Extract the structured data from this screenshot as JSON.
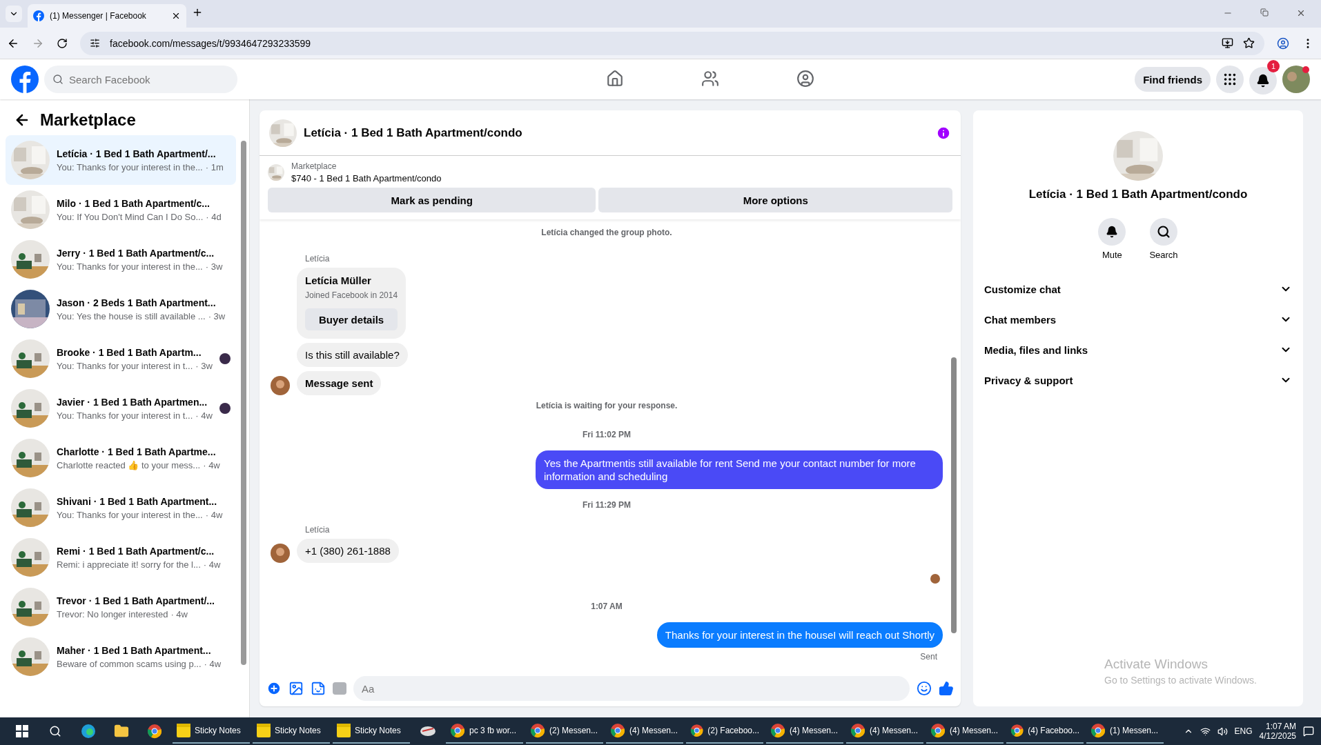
{
  "browser": {
    "tab": {
      "title": "(1) Messenger | Facebook"
    },
    "url": "facebook.com/messages/t/9934647293233599"
  },
  "header": {
    "search": {
      "placeholder": "Search Facebook"
    },
    "nav": [
      {
        "kind": "home",
        "selected": false
      },
      {
        "kind": "friends",
        "selected": false
      },
      {
        "kind": "groups",
        "selected": false
      }
    ],
    "find_friends": "Find friends",
    "notification_count": "1"
  },
  "sidebar": {
    "title": "Marketplace",
    "conversations": [
      {
        "title": "Letícia · 1 Bed 1 Bath Apartment/...",
        "preview": "You: Thanks for your interest in the...",
        "time": "· 1m",
        "selected": true,
        "seen": false
      },
      {
        "title": "Milo · 1 Bed 1 Bath Apartment/c...",
        "preview": "You: If You Don't Mind Can I Do So...",
        "time": "· 4d",
        "selected": false,
        "seen": false
      },
      {
        "title": "Jerry · 1 Bed 1 Bath Apartment/c...",
        "preview": "You: Thanks for your interest in the...",
        "time": "· 3w",
        "selected": false,
        "seen": false
      },
      {
        "title": "Jason · 2 Beds 1 Bath Apartment...",
        "preview": "You: Yes the house is still available ...",
        "time": "· 3w",
        "selected": false,
        "seen": false
      },
      {
        "title": "Brooke · 1 Bed 1 Bath Apartm...",
        "preview": "You: Thanks for your interest in t...",
        "time": "· 3w",
        "selected": false,
        "seen": true
      },
      {
        "title": "Javier · 1 Bed 1 Bath Apartmen...",
        "preview": "You: Thanks for your interest in t...",
        "time": "· 4w",
        "selected": false,
        "seen": true
      },
      {
        "title": "Charlotte · 1 Bed 1 Bath Apartme...",
        "preview": "Charlotte reacted 👍 to your mess...",
        "time": "· 4w",
        "selected": false,
        "seen": false
      },
      {
        "title": "Shivani · 1 Bed 1 Bath Apartment...",
        "preview": "You: Thanks for your interest in the...",
        "time": "· 4w",
        "selected": false,
        "seen": false
      },
      {
        "title": "Remi · 1 Bed 1 Bath Apartment/c...",
        "preview": "Remi: i appreciate it! sorry for the l...",
        "time": "· 4w",
        "selected": false,
        "seen": false
      },
      {
        "title": "Trevor · 1 Bed 1 Bath Apartment/...",
        "preview": "Trevor: No longer interested",
        "time": "· 4w",
        "selected": false,
        "seen": false
      },
      {
        "title": "Maher · 1 Bed 1 Bath Apartment...",
        "preview": "Beware of common scams using p...",
        "time": "· 4w",
        "selected": false,
        "seen": false
      }
    ]
  },
  "chat": {
    "title": "Letícia · 1 Bed 1 Bath Apartment/condo",
    "listing": {
      "label": "Marketplace",
      "title": "$740 - 1 Bed 1 Bath Apartment/condo"
    },
    "actions": [
      "Mark as pending",
      "More options"
    ],
    "messages": [
      {
        "kind": "system",
        "text": "Letícia changed the group photo."
      },
      {
        "kind": "sender",
        "text": "Letícia"
      },
      {
        "kind": "profile",
        "name": "Letícia Müller",
        "detail": "Joined Facebook in 2014",
        "button": "Buyer details"
      },
      {
        "kind": "incoming",
        "text": "Is this still available?",
        "avatar": false
      },
      {
        "kind": "incoming",
        "text": "Message sent",
        "avatar": true
      },
      {
        "kind": "system",
        "text": "Letícia is waiting for your response."
      },
      {
        "kind": "time",
        "text": "Fri 11:02 PM"
      },
      {
        "kind": "outgoing",
        "text": "Yes the Apartmentis still available for rent Send me your contact number for more information and  scheduling",
        "color": "#4a4af6"
      },
      {
        "kind": "time",
        "text": "Fri 11:29 PM"
      },
      {
        "kind": "sender",
        "text": "Letícia"
      },
      {
        "kind": "incoming",
        "text": "+1 (380) 261-1888",
        "avatar": true
      },
      {
        "kind": "seen"
      },
      {
        "kind": "time",
        "text": "1:07 AM"
      },
      {
        "kind": "outgoing",
        "text": "Thanks for your interest in the houseI will reach out Shortly",
        "color": "#0a7cff"
      },
      {
        "kind": "status",
        "text": "Sent"
      }
    ],
    "composer": {
      "placeholder": "Aa"
    }
  },
  "details": {
    "title": "Letícia · 1 Bed 1 Bath Apartment/condo",
    "actions": [
      {
        "kind": "mute",
        "label": "Mute"
      },
      {
        "kind": "search",
        "label": "Search"
      }
    ],
    "sections": [
      {
        "label": "Customize chat",
        "expanded": false
      },
      {
        "label": "Chat members",
        "expanded": false
      },
      {
        "label": "Media, files and links",
        "expanded": false
      },
      {
        "label": "Privacy & support",
        "expanded": false
      }
    ]
  },
  "activation_notice": {
    "title": "Activate Windows",
    "text": "Go to Settings to activate Windows."
  },
  "taskbar": {
    "apps": [
      {
        "kind": "notes",
        "label": "Sticky Notes"
      },
      {
        "kind": "notes",
        "label": "Sticky Notes"
      },
      {
        "kind": "notes",
        "label": "Sticky Notes"
      },
      {
        "kind": "misc"
      },
      {
        "kind": "chrome",
        "label": "pc 3 fb wor..."
      },
      {
        "kind": "chrome",
        "label": "(2) Messen..."
      },
      {
        "kind": "chrome",
        "label": "(4) Messen..."
      },
      {
        "kind": "chrome",
        "label": "(2) Faceboo..."
      },
      {
        "kind": "chrome",
        "label": "(4) Messen..."
      },
      {
        "kind": "chrome",
        "label": "(4) Messen..."
      },
      {
        "kind": "chrome",
        "label": "(4) Messen..."
      },
      {
        "kind": "chrome",
        "label": "(4) Faceboo..."
      },
      {
        "kind": "chrome",
        "label": "(1) Messen..."
      }
    ],
    "language": "ENG",
    "time": "1:07 AM",
    "date": "4/12/2025"
  }
}
